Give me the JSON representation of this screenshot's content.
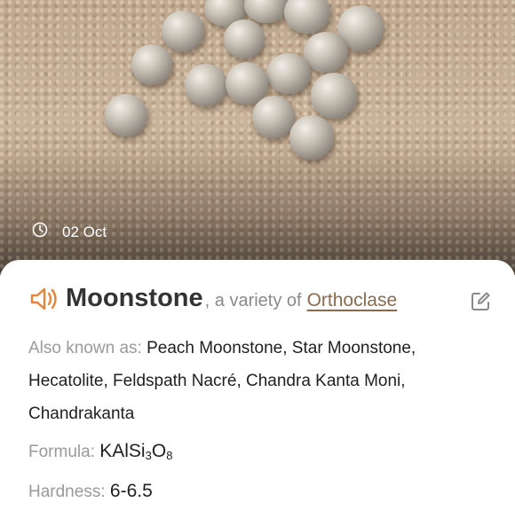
{
  "photo": {
    "date": "02 Oct"
  },
  "mineral": {
    "name": "Moonstone",
    "variety_prefix": ", a variety of",
    "parent": "Orthoclase",
    "also_known_label": "Also known as:",
    "also_known_value": "Peach Moonstone, Star Moonstone, Hecatolite, Feldspath Nacré, Chandra Kanta Moni, Chandrakanta",
    "formula_label": "Formula:",
    "formula": {
      "a": "KAlSi",
      "s1": "3",
      "b": "O",
      "s2": "8"
    },
    "hardness_label": "Hardness:",
    "hardness_value": "6-6.5"
  },
  "colors": {
    "accent": "#e8833a",
    "link": "#8a6a4f",
    "label": "#9a9a9a"
  },
  "icons": [
    "clock-icon",
    "speaker-icon",
    "edit-icon"
  ]
}
